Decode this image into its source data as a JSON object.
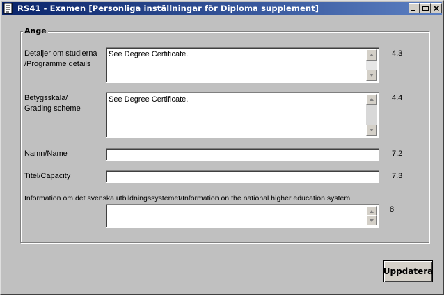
{
  "window": {
    "title": "RS41 - Examen [Personliga inställningar för Diploma supplement]"
  },
  "group": {
    "legend": "Ange",
    "fields": [
      {
        "label": "Detaljer om studierna\n/Programme details",
        "value": "See Degree Certificate.",
        "ref": "4.3"
      },
      {
        "label": "Betygsskala/\nGrading scheme",
        "value": "See Degree Certificate.",
        "ref": "4.4"
      },
      {
        "label": "Namn/Name",
        "value": "",
        "ref": "7.2"
      },
      {
        "label": "Titel/Capacity",
        "value": "",
        "ref": "7.3"
      },
      {
        "label": "Information om det svenska utbildningssystemet/Information on the national higher education system",
        "value": "",
        "ref": "8"
      }
    ]
  },
  "actions": {
    "update_label": "Uppdatera"
  },
  "icons": {
    "app": "document-icon",
    "minimize": "minimize-icon",
    "maximize": "maximize-icon",
    "close": "close-icon",
    "scroll_up": "arrow-up-icon",
    "scroll_down": "arrow-down-icon"
  }
}
